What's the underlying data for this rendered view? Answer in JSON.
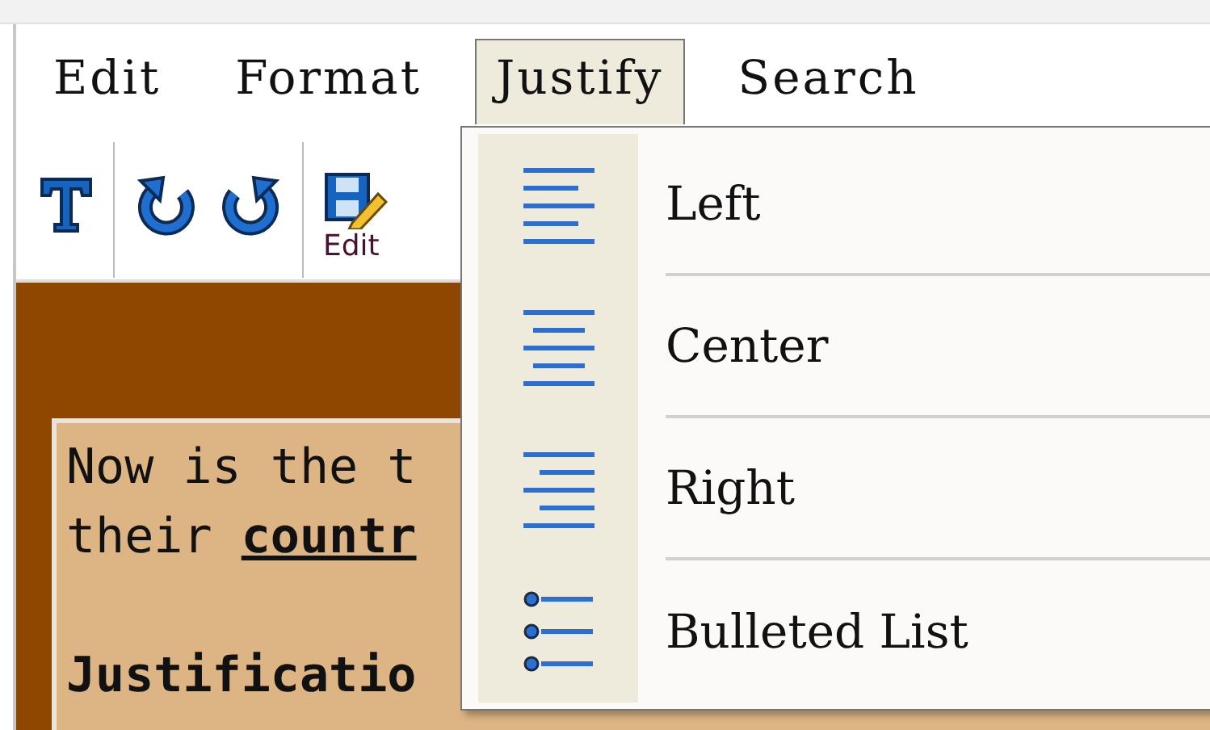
{
  "menu_bar": [
    {
      "label": "Edit",
      "selected": false
    },
    {
      "label": "Format",
      "selected": false
    },
    {
      "label": "Justify",
      "selected": true
    },
    {
      "label": "Search",
      "selected": false
    }
  ],
  "toolbar": [
    {
      "kind": "text"
    },
    {
      "kind": "separator"
    },
    {
      "kind": "redo"
    },
    {
      "kind": "undo"
    },
    {
      "kind": "separator"
    },
    {
      "kind": "save-edit",
      "label": "Edit"
    }
  ],
  "document": {
    "paragraphs": [
      {
        "kind": "body",
        "lines": [
          "Now is the t",
          "their **countr**"
        ]
      },
      {
        "kind": "heading",
        "lines": [
          "Justificatio"
        ]
      }
    ]
  },
  "dropdown": {
    "items": [
      {
        "kind": "left",
        "label": "Left"
      },
      {
        "kind": "center",
        "label": "Center"
      },
      {
        "kind": "right",
        "label": "Right"
      },
      {
        "kind": "bulleted",
        "label": "Bulleted List"
      }
    ]
  }
}
